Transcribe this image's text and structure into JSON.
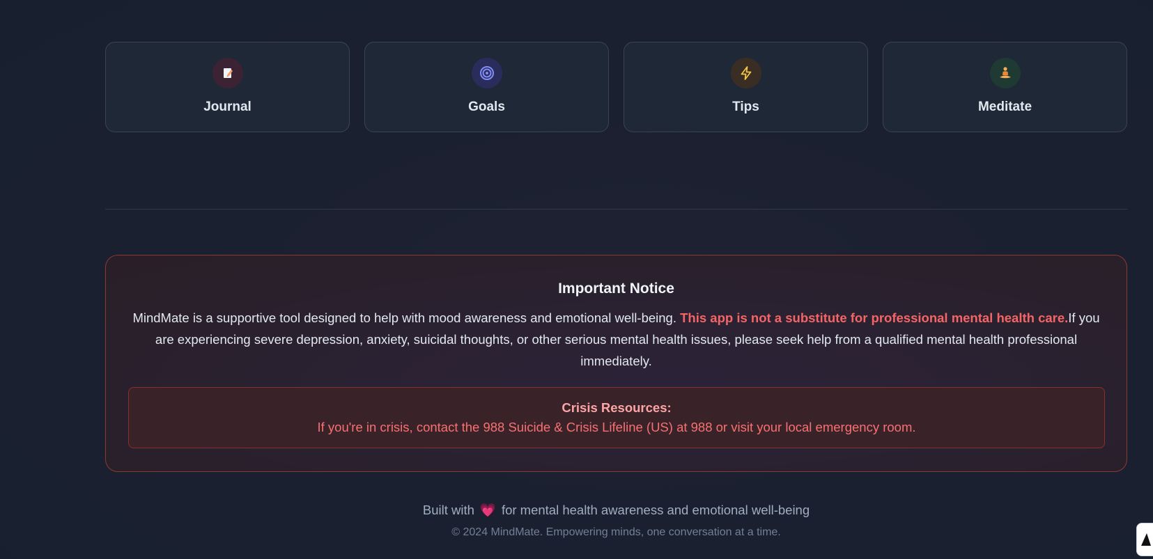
{
  "quick_actions": [
    {
      "label": "Journal",
      "icon": "memo-icon",
      "icon_bg": "#3b2333",
      "icon_color": "#f6c2d6"
    },
    {
      "label": "Goals",
      "icon": "target-icon",
      "icon_bg": "#2a2d5c",
      "icon_color": "#818cf8"
    },
    {
      "label": "Tips",
      "icon": "lightning-icon",
      "icon_bg": "#3a2e24",
      "icon_color": "#f6c343"
    },
    {
      "label": "Meditate",
      "icon": "meditation-icon",
      "icon_bg": "#1e3a33",
      "icon_color": "#f6ad55"
    }
  ],
  "notice": {
    "title": "Important Notice",
    "intro": "MindMate is a supportive tool designed to help with mood awareness and emotional well-being. ",
    "warning": "This app is not a substitute for professional mental health care.",
    "body": "If you are experiencing severe depression, anxiety, suicidal thoughts, or other serious mental health issues, please seek help from a qualified mental health professional immediately.",
    "crisis": {
      "title": "Crisis Resources:",
      "text": "If you're in crisis, contact the 988 Suicide & Crisis Lifeline (US) at 988 or visit your local emergency room."
    }
  },
  "footer": {
    "built_with": "Built with",
    "heart": "💗",
    "tagline": "for mental health awareness and emotional well-being",
    "copyright": "© 2024 MindMate. Empowering minds, one conversation at a time."
  },
  "colors": {
    "accent_red": "#f56565",
    "background": "#1a202c"
  }
}
